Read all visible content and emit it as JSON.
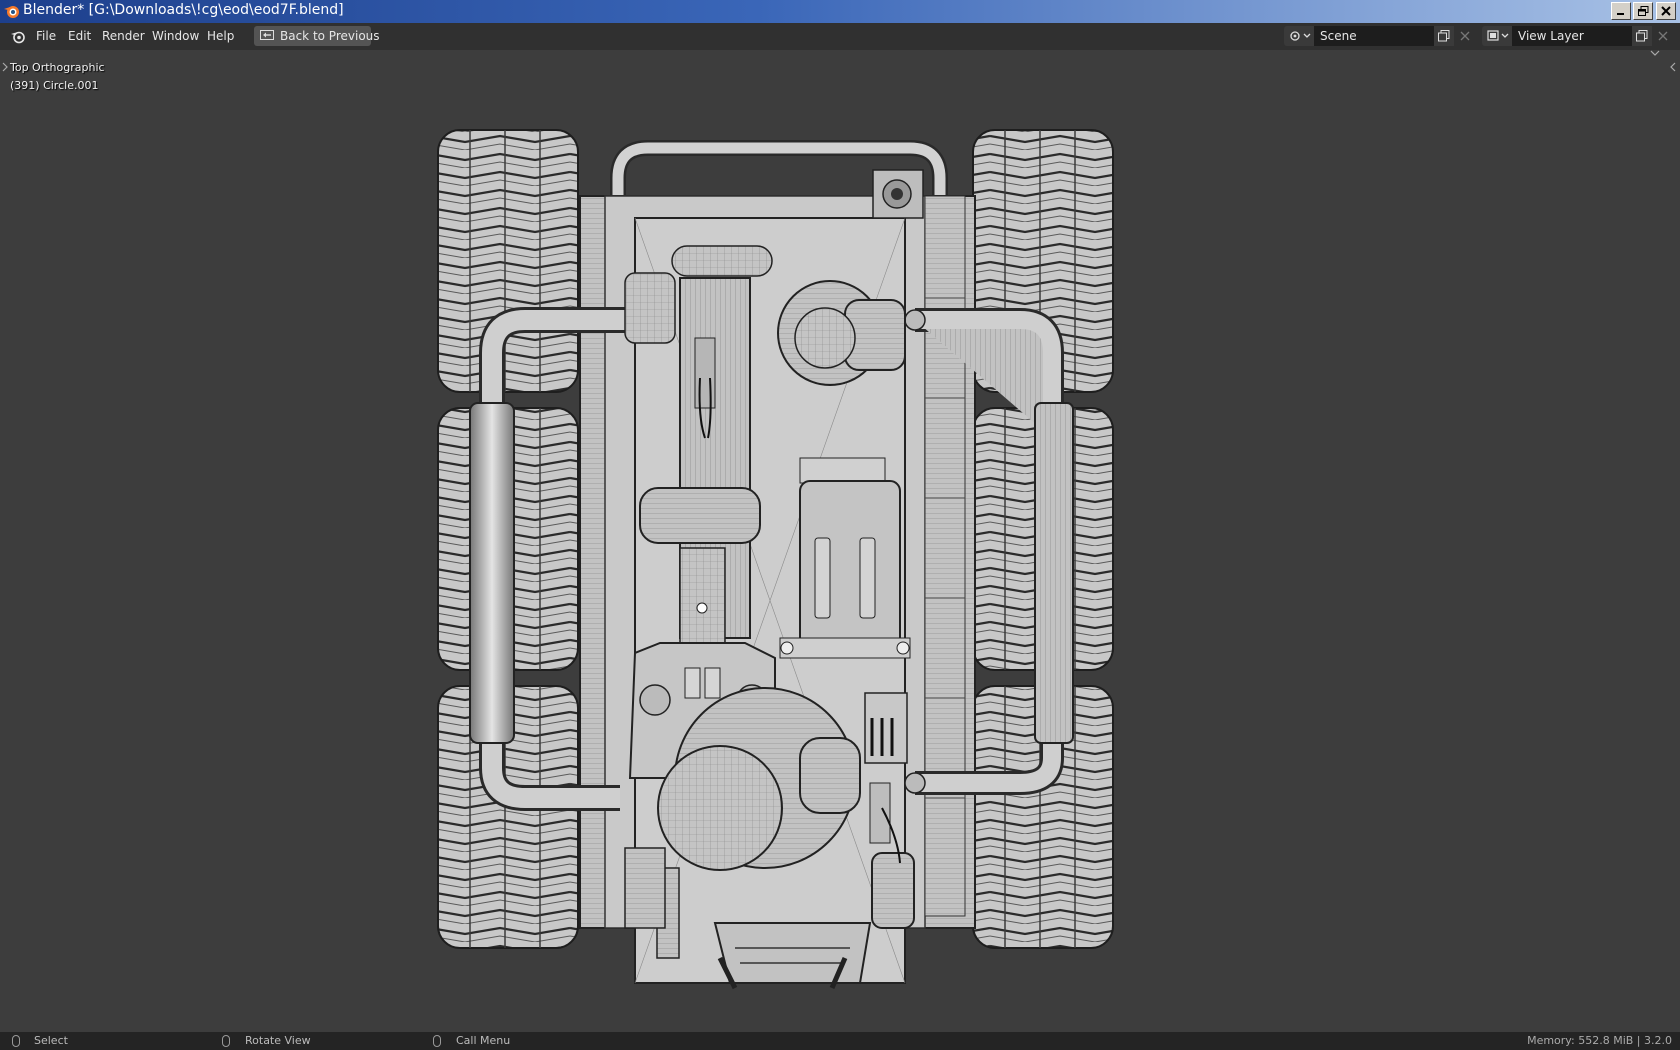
{
  "window": {
    "title": "Blender* [G:\\Downloads\\!cg\\eod\\eod7F.blend]",
    "controls": [
      "minimize",
      "restore",
      "close"
    ]
  },
  "menubar": {
    "items": [
      "File",
      "Edit",
      "Render",
      "Window",
      "Help"
    ],
    "back_button": "Back to Previous",
    "scene": {
      "value": "Scene"
    },
    "view_layer": {
      "value": "View Layer"
    }
  },
  "viewport": {
    "view_name": "Top Orthographic",
    "object_info": "(391) Circle.001"
  },
  "statusbar": {
    "select": "Select",
    "rotate": "Rotate View",
    "call_menu": "Call Menu",
    "memory": "Memory: 552.8 MiB | 3.2.0"
  },
  "colors": {
    "title_gradient_start": "#1d3f8c",
    "title_gradient_end": "#a9c2e6",
    "menubar_bg": "#303030",
    "viewport_bg": "#3d3d3d",
    "statusbar_bg": "#242424",
    "mesh_light": "#cfcfcf",
    "mesh_dark": "#2a2a2a"
  }
}
